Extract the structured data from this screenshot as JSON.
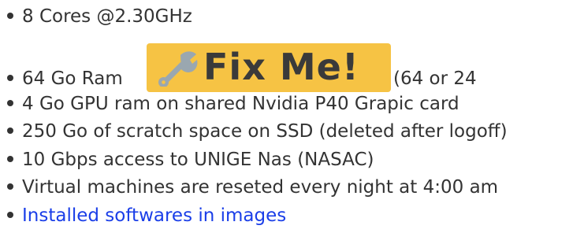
{
  "items": [
    {
      "text": "8 Cores @2.30GHz"
    },
    {
      "text": "64 Go Ram",
      "badge": {
        "icon": "wrench-icon",
        "label": "Fix Me!"
      },
      "after": "(64 or 24"
    },
    {
      "text": "4 Go GPU ram on shared Nvidia P40 Grapic card"
    },
    {
      "text": "250 Go of scratch space on SSD (deleted after logoff)"
    },
    {
      "text": "10 Gbps access to UNIGE Nas (NASAC)"
    },
    {
      "text": "Virtual machines are reseted every night at 4:00 am"
    },
    {
      "text": "Installed softwares in images",
      "link": true
    }
  ],
  "colors": {
    "text": "#333333",
    "link": "#1a3ee8",
    "badge_bg": "#f6c344"
  }
}
